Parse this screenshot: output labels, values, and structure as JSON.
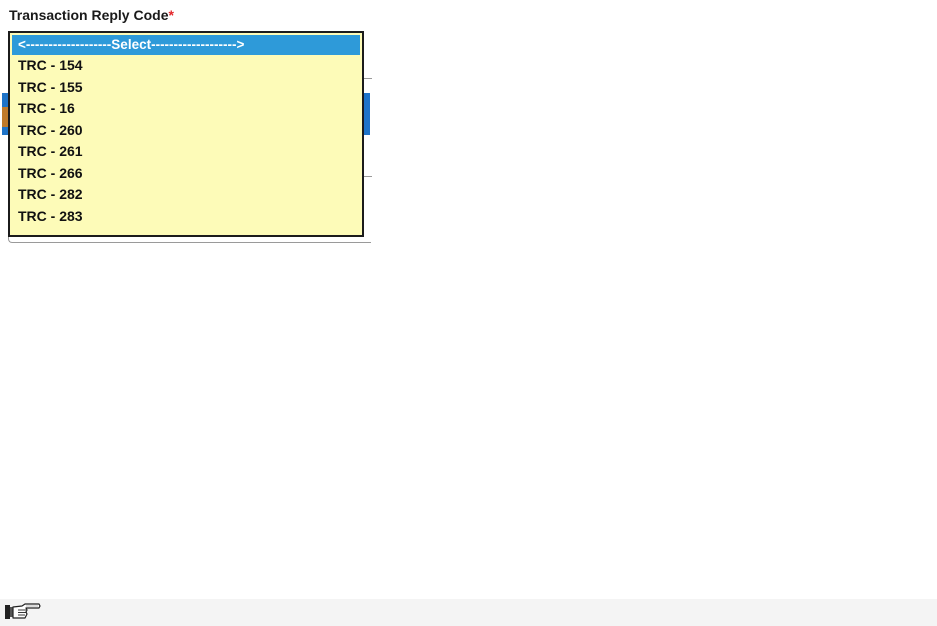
{
  "field": {
    "label": "Transaction Reply Code",
    "required_marker": "*"
  },
  "dropdown": {
    "selected_label": "<-------------------Select------------------->",
    "options": [
      "TRC - 154",
      "TRC - 155",
      "TRC - 16",
      "TRC - 260",
      "TRC - 261",
      "TRC - 266",
      "TRC - 282",
      "TRC - 283"
    ]
  },
  "status_bar": {
    "icon": "pointing-hand-icon"
  },
  "colors": {
    "selected_bg": "#2e9ad9",
    "list_bg": "#fdfbb8",
    "required": "#e3262a",
    "blue_bar": "#1e73c8"
  }
}
